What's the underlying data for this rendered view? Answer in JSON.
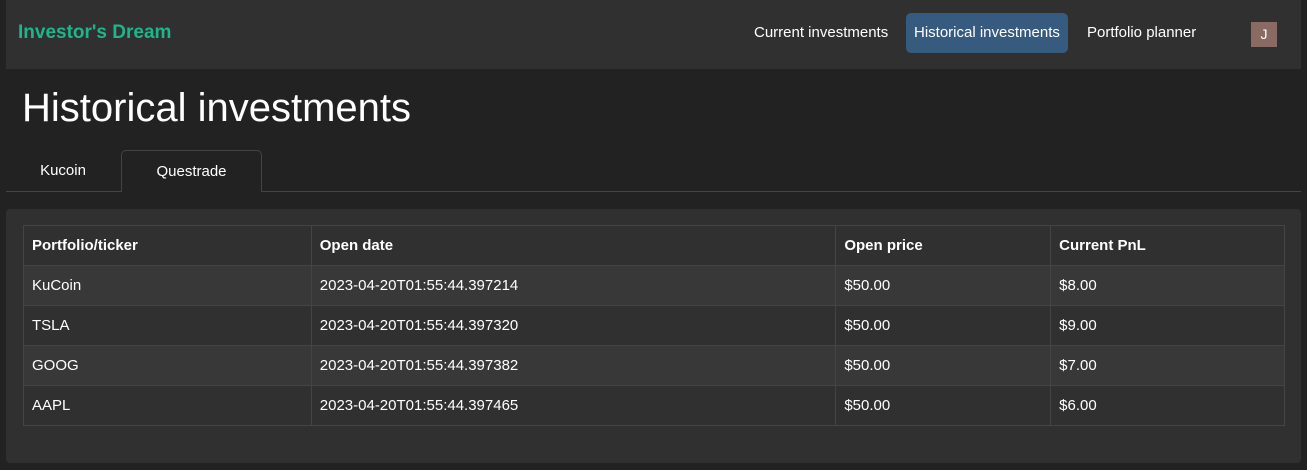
{
  "app": {
    "brand": "Investor's Dream"
  },
  "nav": {
    "items": [
      {
        "label": "Current investments",
        "active": false
      },
      {
        "label": "Historical investments",
        "active": true
      },
      {
        "label": "Portfolio planner",
        "active": false
      }
    ],
    "avatar_initial": "J"
  },
  "page": {
    "title": "Historical investments"
  },
  "tabs": [
    {
      "label": "Kucoin",
      "active": false
    },
    {
      "label": "Questrade",
      "active": true
    }
  ],
  "table": {
    "headers": [
      "Portfolio/ticker",
      "Open date",
      "Open price",
      "Current PnL"
    ],
    "rows": [
      [
        "KuCoin",
        "2023-04-20T01:55:44.397214",
        "$50.00",
        "$8.00"
      ],
      [
        "TSLA",
        "2023-04-20T01:55:44.397320",
        "$50.00",
        "$9.00"
      ],
      [
        "GOOG",
        "2023-04-20T01:55:44.397382",
        "$50.00",
        "$7.00"
      ],
      [
        "AAPL",
        "2023-04-20T01:55:44.397465",
        "$50.00",
        "$6.00"
      ]
    ]
  },
  "colors": {
    "brand": "#1fb58b",
    "nav_active": "#375a7f",
    "background": "#222222",
    "surface": "#303030",
    "row_stripe": "#383838",
    "avatar": "#8a6b64"
  }
}
